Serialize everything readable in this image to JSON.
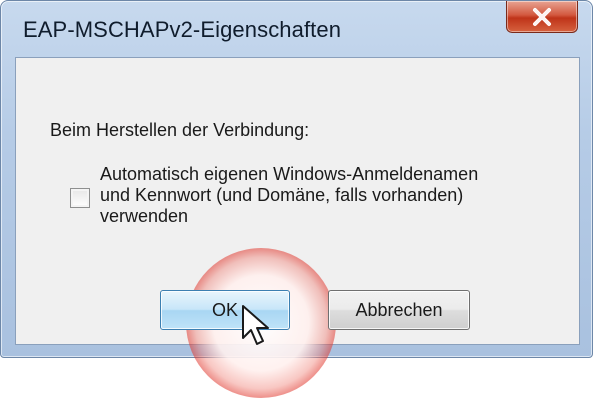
{
  "window": {
    "title": "EAP-MSCHAPv2-Eigenschaften",
    "close_icon": "close-icon"
  },
  "group": {
    "label": "Beim Herstellen der Verbindung:"
  },
  "checkbox": {
    "checked": false,
    "label_lines": [
      "Automatisch eigenen Windows-Anmeldenamen",
      "und Kennwort (und Domäne, falls vorhanden)",
      "verwenden"
    ]
  },
  "buttons": {
    "ok_label": "OK",
    "cancel_label": "Abbrechen"
  },
  "colors": {
    "titlebar": "#b5cbe6",
    "close_button": "#c8401f",
    "client_background": "#f0f0f0",
    "ok_button_accent": "#3c7fb1",
    "click_highlight": "#e13c32"
  },
  "cursor_icon": "mouse-pointer-icon"
}
